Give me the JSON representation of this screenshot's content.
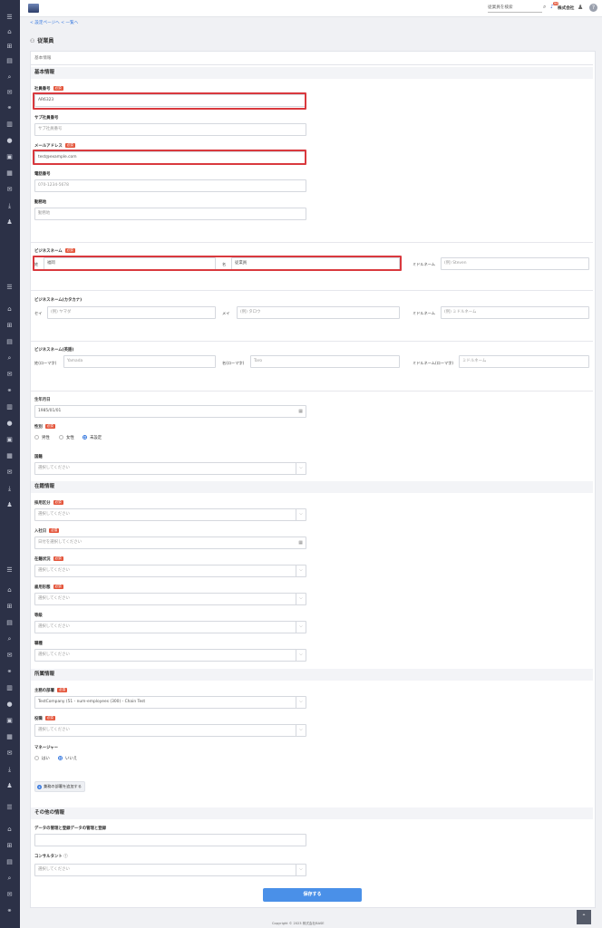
{
  "header": {
    "search_placeholder": "従業員を検索",
    "notifications": "99",
    "company": "株式会社",
    "breadcrumb": "< 設定ページへ < 一覧へ"
  },
  "page_title": "従業員",
  "tab": "基本情報",
  "required": "必須",
  "sections": {
    "basic": "基本情報",
    "employment": "在籍情報",
    "affiliation": "所属情報",
    "other": "その他の情報"
  },
  "fields": {
    "employee_no": {
      "label": "社員番号",
      "value": "AR6323"
    },
    "sub_employee_no": {
      "label": "サブ社員番号",
      "placeholder": "サブ社員番号"
    },
    "email": {
      "label": "メールアドレス",
      "value": "test@example.com"
    },
    "phone": {
      "label": "電話番号",
      "placeholder": "070-1234-5678"
    },
    "work_location": {
      "label": "勤務地",
      "placeholder": "勤務地"
    },
    "business_name": {
      "label": "ビジネスネーム",
      "last_label": "姓",
      "last_value": "福岡",
      "first_label": "名",
      "first_value": "従業員",
      "middle_label": "ミドルネーム",
      "middle_placeholder": "(例) Steven"
    },
    "business_name_kana": {
      "label": "ビジネスネーム(カタカナ)",
      "last_label": "セイ",
      "last_placeholder": "(例) ヤマダ",
      "first_label": "メイ",
      "first_placeholder": "(例) タロウ",
      "middle_label": "ミドルネーム",
      "middle_placeholder": "(例) ミドルネーム"
    },
    "business_name_roman": {
      "label": "ビジネスネーム(英語)",
      "last_label": "姓(ローマ字)",
      "last_placeholder": "Yamada",
      "first_label": "名(ローマ字)",
      "first_placeholder": "Taro",
      "middle_label": "ミドルネーム(ローマ字)",
      "middle_placeholder": "ミドルネーム"
    },
    "birthday": {
      "label": "生年月日",
      "value": "1985/01/01"
    },
    "gender": {
      "label": "性別",
      "options": [
        "男性",
        "女性",
        "未設定"
      ]
    },
    "nationality": {
      "label": "国籍",
      "placeholder": "選択してください"
    },
    "employment_type": {
      "label": "採用区分",
      "placeholder": "選択してください"
    },
    "join_date": {
      "label": "入社日",
      "placeholder": "日付を選択してください"
    },
    "status": {
      "label": "在籍状況",
      "placeholder": "選択してください"
    },
    "contract_type": {
      "label": "雇用形態",
      "placeholder": "選択してください"
    },
    "grade": {
      "label": "等級",
      "placeholder": "選択してください"
    },
    "job": {
      "label": "職種",
      "placeholder": "選択してください"
    },
    "main_department": {
      "label": "主務の部署",
      "value": "TestCompany (51 - num-employees (300) - Chain Test"
    },
    "position": {
      "label": "役職",
      "placeholder": "選択してください"
    },
    "manager": {
      "label": "マネージャー",
      "options": [
        "はい",
        "いいえ"
      ]
    },
    "add_department": "兼務の部署を追加する",
    "data_manager": {
      "label": "データの管理と登録データの管理と登録"
    },
    "consultant": {
      "label": "コンサルタント",
      "placeholder": "選択してください"
    }
  },
  "save_button": "保存する",
  "footer": "Copyright © 2023 株式会社BASE"
}
